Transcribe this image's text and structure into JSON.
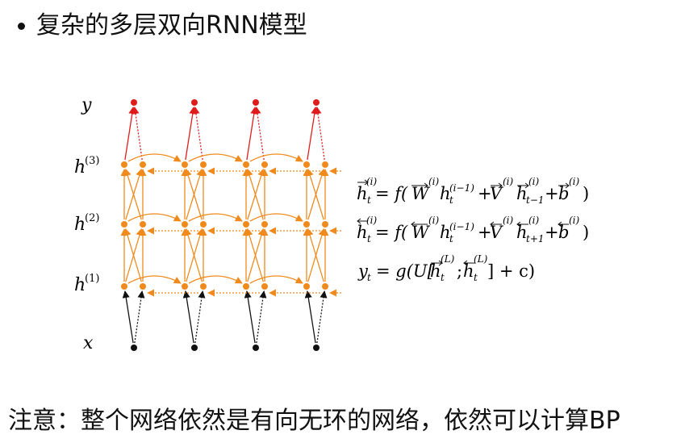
{
  "title": "复杂的多层双向RNN模型",
  "note": "注意：整个网络依然是有向无环的网络，依然可以计算BP",
  "layer_labels": {
    "y": "y",
    "h3": "h",
    "h3_sup": "(3)",
    "h2": "h",
    "h2_sup": "(2)",
    "h1": "h",
    "h1_sup": "(1)",
    "x": "x"
  },
  "equations": {
    "eq1": {
      "lhs": "h",
      "lhs_sub": "t",
      "lhs_sup": "(i)",
      "eq_f": "= f(",
      "W": "W",
      "W_sup": "(i)",
      "h_prev": "h",
      "h_prev_sub": "t",
      "h_prev_sup": "(i−1)",
      "plus1": "+",
      "V": "V",
      "V_sup": "(i)",
      "h_rec": "h",
      "h_rec_sub": "t−1",
      "h_rec_sup": "(i)",
      "plus2": "+",
      "b": "b",
      "b_sup": "(i)",
      "close": ")"
    },
    "eq2": {
      "lhs": "h",
      "lhs_sub": "t",
      "lhs_sup": "(i)",
      "eq_f": "= f(",
      "W": "W",
      "W_sup": "(i)",
      "h_prev": "h",
      "h_prev_sub": "t",
      "h_prev_sup": "(i−1)",
      "plus1": "+",
      "V": "V",
      "V_sup": "(i)",
      "h_rec": "h",
      "h_rec_sub": "t+1",
      "h_rec_sup": "(i)",
      "plus2": "+",
      "b": "b",
      "b_sup": "(i)",
      "close": ")"
    },
    "eq3": {
      "lhs": "y",
      "lhs_sub": "t",
      "eq_g": "= g(U[",
      "hf": "h",
      "hf_sub": "t",
      "hf_sup": "(L)",
      "semi": ";",
      "hb": "h",
      "hb_sub": "t",
      "hb_sup": "(L)",
      "tail": "] + c)"
    }
  },
  "colors": {
    "output": "#e01b1b",
    "hidden": "#f08a1c",
    "input": "#111111",
    "text": "#111111"
  },
  "diagram": {
    "timesteps": 4,
    "hidden_layers": 3
  }
}
